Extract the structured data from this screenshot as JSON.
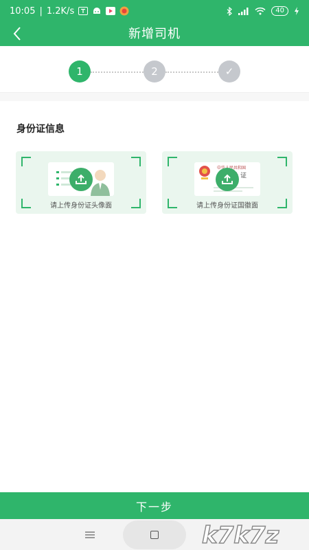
{
  "status_bar": {
    "time": "10:05",
    "speed": "1.2K/s",
    "battery": "40"
  },
  "header": {
    "title": "新增司机"
  },
  "stepper": {
    "steps": [
      "1",
      "2",
      "✓"
    ]
  },
  "section": {
    "title": "身份证信息"
  },
  "cards": [
    {
      "label": "请上传身份证头像面"
    },
    {
      "label": "请上传身份证国徽面",
      "thumb_text_1": "中华人民共和国",
      "thumb_text_2": "身份证"
    }
  ],
  "footer": {
    "next_label": "下一步"
  },
  "watermark": "k7k7z",
  "colors": {
    "primary": "#2fb56b",
    "step_inactive": "#c5c8cd",
    "card_bg": "#eaf6ee"
  }
}
